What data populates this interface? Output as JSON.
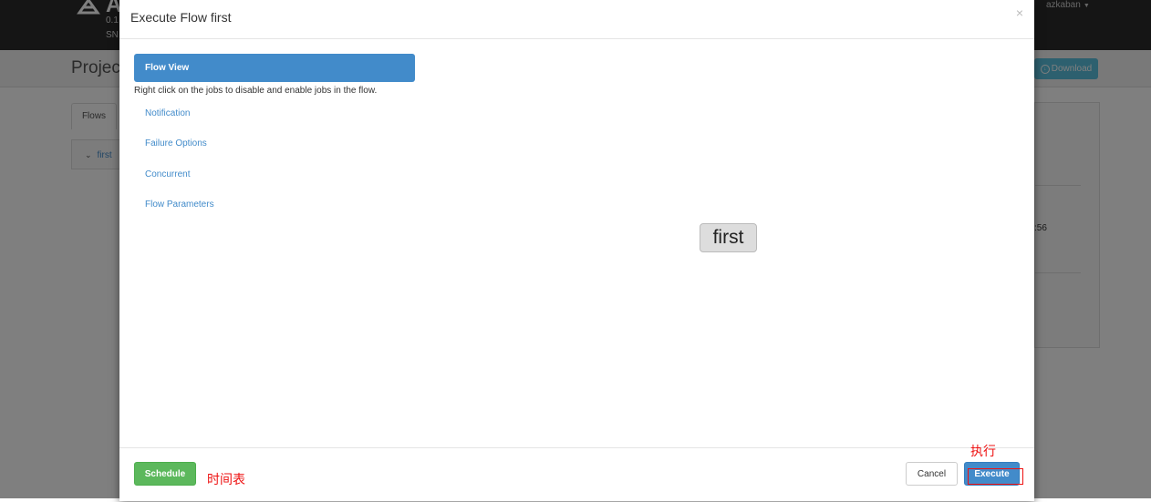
{
  "background": {
    "brand_fragment": "A",
    "version_fragment": "0.1",
    "sn_fragment": "SN",
    "user": "azkaban",
    "title_fragment": "Project",
    "download_label": "Download",
    "tab_label": "Flows",
    "flow_item": "first",
    "time_fragment": ":56"
  },
  "modal": {
    "title": "Execute Flow first",
    "close": "×",
    "nav": {
      "active_label": "Flow View",
      "hint": "Right click on the jobs to disable and enable jobs in the flow.",
      "items": [
        "Notification",
        "Failure Options",
        "Concurrent",
        "Flow Parameters"
      ]
    },
    "graph": {
      "node_label": "first"
    },
    "footer": {
      "schedule_label": "Schedule",
      "cancel_label": "Cancel",
      "execute_label": "Execute"
    }
  },
  "annotations": {
    "schedule_note": "时间表",
    "execute_note": "执行"
  },
  "colors": {
    "primary": "#428bca",
    "success": "#5cb85c",
    "annotation": "#e11111",
    "navbar": "#2b2b2b"
  }
}
